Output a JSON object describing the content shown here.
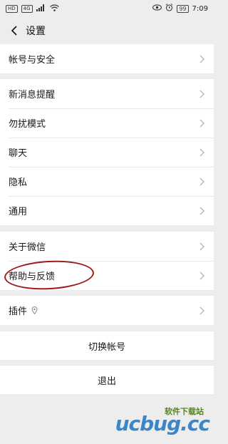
{
  "statusbar": {
    "left_badges": [
      "HD",
      "4G"
    ],
    "battery": "99",
    "time": "7:09"
  },
  "navbar": {
    "title": "设置"
  },
  "groups": {
    "account": {
      "items": [
        {
          "label": "帐号与安全"
        }
      ]
    },
    "general": {
      "items": [
        {
          "label": "新消息提醒"
        },
        {
          "label": "勿扰模式"
        },
        {
          "label": "聊天"
        },
        {
          "label": "隐私"
        },
        {
          "label": "通用"
        }
      ]
    },
    "about": {
      "items": [
        {
          "label": "关于微信"
        },
        {
          "label": "帮助与反馈"
        }
      ]
    },
    "plugins": {
      "items": [
        {
          "label": "插件"
        }
      ]
    }
  },
  "actions": {
    "switch_account": "切换帐号",
    "logout": "退出"
  },
  "watermark": {
    "top_text": "软件下载站",
    "brand": "ucbug.cc"
  },
  "colors": {
    "page_bg": "#ededed",
    "row_bg": "#ffffff",
    "divider": "#e6e6e6",
    "annotation_red": "#9e1b1b",
    "watermark_blue": "#3a86c8",
    "watermark_orange": "#f39a1b"
  }
}
